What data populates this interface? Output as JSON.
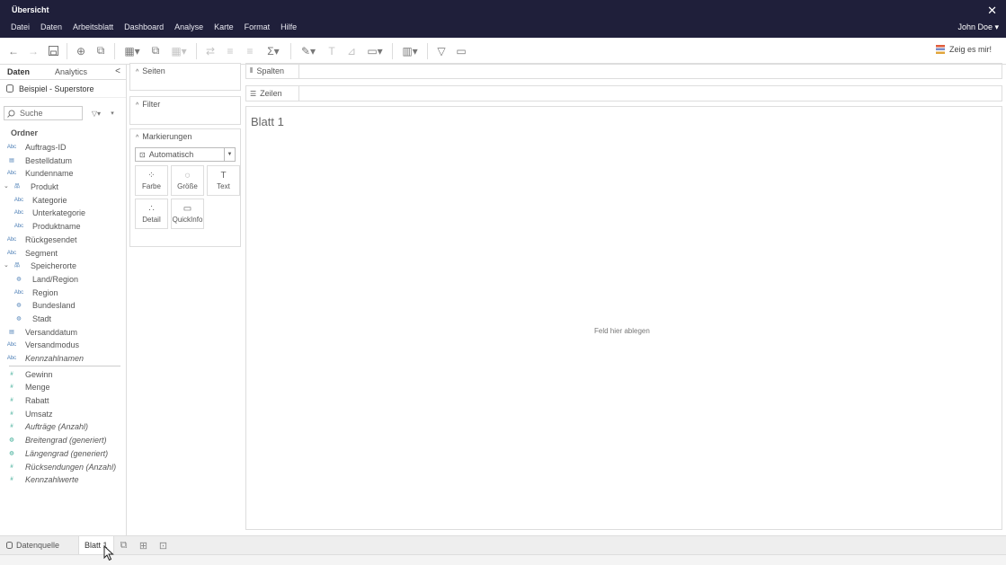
{
  "window": {
    "title": "Übersicht",
    "close_label": "✕",
    "user": "John Doe ▾"
  },
  "menu": [
    "Datei",
    "Daten",
    "Arbeitsblatt",
    "Dashboard",
    "Analyse",
    "Karte",
    "Format",
    "Hilfe"
  ],
  "toolbar": {
    "show_me": "Zeig es mir!"
  },
  "datapane": {
    "tab_data": "Daten",
    "tab_analytics": "Analytics",
    "collapse": "<",
    "source": "Beispiel - Superstore",
    "search_placeholder": "Suche",
    "folder_heading": "Ordner",
    "dimensions": [
      {
        "icon": "Abc",
        "label": "Auftrags-ID",
        "level": 0
      },
      {
        "icon": "▤",
        "label": "Bestelldatum",
        "level": 0
      },
      {
        "icon": "Abc",
        "label": "Kundenname",
        "level": 0
      },
      {
        "icon": "品",
        "label": "Produkt",
        "level": 0,
        "expandable": true
      },
      {
        "icon": "Abc",
        "label": "Kategorie",
        "level": 1
      },
      {
        "icon": "Abc",
        "label": "Unterkategorie",
        "level": 1
      },
      {
        "icon": "Abc",
        "label": "Produktname",
        "level": 1
      },
      {
        "icon": "Abc",
        "label": "Rückgesendet",
        "level": 0
      },
      {
        "icon": "Abc",
        "label": "Segment",
        "level": 0
      },
      {
        "icon": "品",
        "label": "Speicherorte",
        "level": 0,
        "expandable": true
      },
      {
        "icon": "◍",
        "label": "Land/Region",
        "level": 1
      },
      {
        "icon": "Abc",
        "label": "Region",
        "level": 1
      },
      {
        "icon": "◍",
        "label": "Bundesland",
        "level": 1
      },
      {
        "icon": "◍",
        "label": "Stadt",
        "level": 1
      },
      {
        "icon": "▤",
        "label": "Versanddatum",
        "level": 0
      },
      {
        "icon": "Abc",
        "label": "Versandmodus",
        "level": 0
      },
      {
        "icon": "Abc",
        "label": "Kennzahlnamen",
        "level": 0,
        "italic": true
      }
    ],
    "measures": [
      {
        "icon": "#",
        "label": "Gewinn"
      },
      {
        "icon": "#",
        "label": "Menge"
      },
      {
        "icon": "#",
        "label": "Rabatt"
      },
      {
        "icon": "#",
        "label": "Umsatz"
      },
      {
        "icon": "#",
        "label": "Aufträge (Anzahl)",
        "italic": true
      },
      {
        "icon": "◍",
        "label": "Breitengrad (generiert)",
        "italic": true
      },
      {
        "icon": "◍",
        "label": "Längengrad (generiert)",
        "italic": true
      },
      {
        "icon": "#",
        "label": "Rücksendungen (Anzahl)",
        "italic": true
      },
      {
        "icon": "#",
        "label": "Kennzahlwerte",
        "italic": true
      }
    ]
  },
  "cards": {
    "pages": "Seiten",
    "filters": "Filter",
    "marks": "Markierungen",
    "mark_type": "Automatisch",
    "mark_buttons": [
      {
        "glyph": "⁘",
        "label": "Farbe"
      },
      {
        "glyph": "◌",
        "label": "Größe"
      },
      {
        "glyph": "T",
        "label": "Text"
      },
      {
        "glyph": "∴",
        "label": "Detail"
      },
      {
        "glyph": "▭",
        "label": "QuickInfo"
      }
    ]
  },
  "shelves": {
    "columns": "Spalten",
    "rows": "Zeilen"
  },
  "canvas": {
    "sheet_title": "Blatt 1",
    "drop_hint": "Feld hier ablegen"
  },
  "bottom": {
    "datasource": "Datenquelle",
    "sheet": "Blatt 1"
  }
}
